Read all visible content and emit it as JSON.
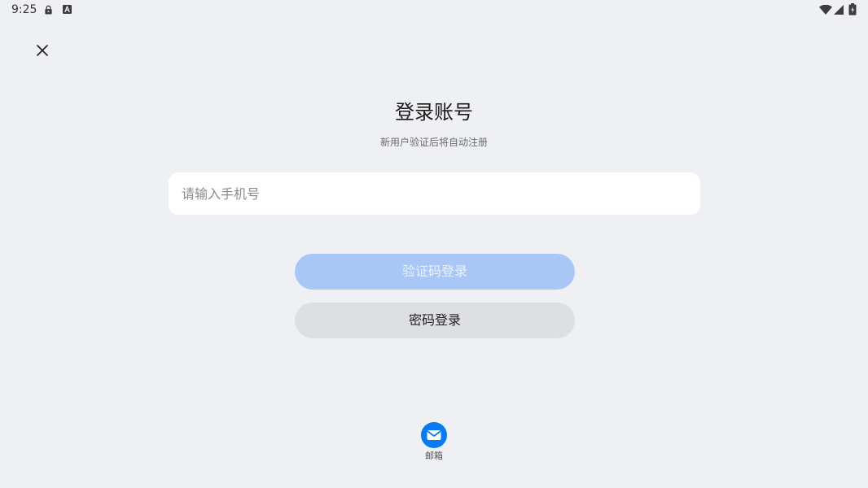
{
  "status_bar": {
    "time": "9:25",
    "left_icons": [
      "lock-icon",
      "font-icon"
    ],
    "right_icons": [
      "wifi-icon",
      "signal-icon",
      "battery-icon"
    ]
  },
  "header": {
    "close_icon": "close-icon"
  },
  "title": "登录账号",
  "subtitle": "新用户验证后将自动注册",
  "phone_input": {
    "placeholder": "请输入手机号",
    "value": ""
  },
  "buttons": {
    "sms_login": "验证码登录",
    "password_login": "密码登录"
  },
  "alt_login": [
    {
      "icon": "mail-icon",
      "label": "邮箱"
    }
  ],
  "colors": {
    "background": "#eff0f3",
    "input_bg": "#ffffff",
    "primary_button": "#a9c7f6",
    "primary_text": "#e9f1fe",
    "secondary_button": "#dedfe2",
    "secondary_text": "#222222",
    "accent": "#0a7af2"
  }
}
